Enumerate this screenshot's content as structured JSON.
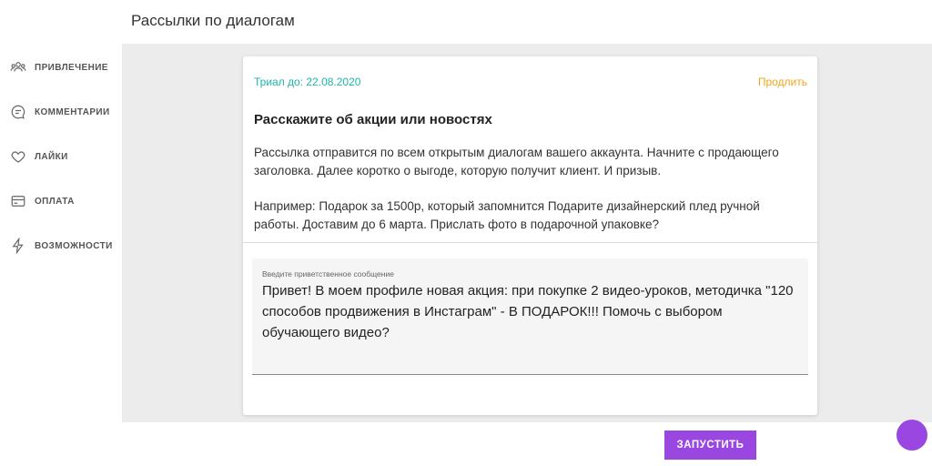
{
  "header": {
    "title": "Рассылки по диалогам"
  },
  "sidebar": {
    "items": [
      {
        "label": "ПРИВЛЕЧЕНИЕ",
        "icon": "users-icon"
      },
      {
        "label": "КОММЕНТАРИИ",
        "icon": "comment-icon"
      },
      {
        "label": "ЛАЙКИ",
        "icon": "heart-icon"
      },
      {
        "label": "ОПЛАТА",
        "icon": "credit-card-icon"
      },
      {
        "label": "ВОЗМОЖНОСТИ",
        "icon": "lightning-icon"
      }
    ]
  },
  "card": {
    "trial_text": "Триал до: 22.08.2020",
    "extend_label": "Продлить",
    "heading": "Расскажите об акции или новостях",
    "description_1": "Рассылка отправится по всем открытым диалогам вашего аккаунта. Начните с продающего заголовка. Далее коротко о выгоде, которую получит клиент. И призыв.",
    "description_2": "Например: Подарок за 1500р, который запомнится Подарите дизайнерский плед ручной работы. Доставим до 6 марта. Прислать фото в подарочной упаковке?",
    "message_field": {
      "label": "Введите приветственное сообщение",
      "value": "Привет! В моем профиле новая акция: при покупке 2 видео-уроков, методичка \"120 способов продвижения в Инстаграм\" - В ПОДАРОК!!! Помочь с выбором обучающего видео?"
    }
  },
  "footer": {
    "launch_label": "ЗАПУСТИТЬ"
  },
  "colors": {
    "accent": "#9a46e0",
    "trial": "#1fb5a8",
    "extend": "#f0a41e"
  }
}
